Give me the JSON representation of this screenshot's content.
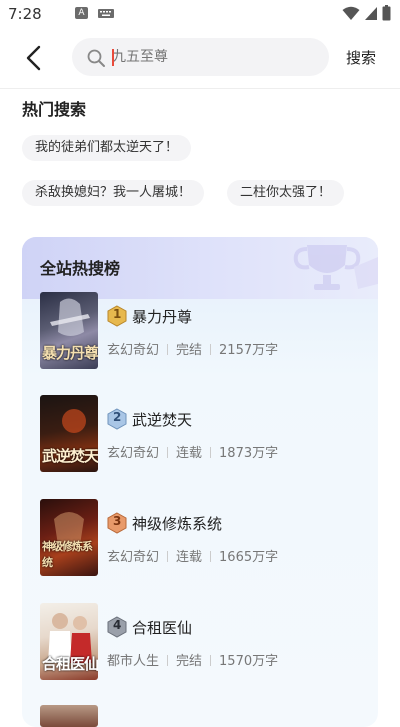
{
  "status": {
    "time": "7:28",
    "notif_letter": "A"
  },
  "search": {
    "placeholder": "九五至尊",
    "button_label": "搜索"
  },
  "hot_search": {
    "title": "热门搜索",
    "chips": [
      "我的徒弟们都太逆天了！",
      "杀敌换媳妇？我一人屠城！",
      "二柱你太强了！"
    ]
  },
  "ranking": {
    "title": "全站热搜榜",
    "books": [
      {
        "rank": "1",
        "name": "暴力丹尊",
        "genre": "玄幻奇幻",
        "status": "完结",
        "words": "2157万字",
        "cover_text": "暴力丹尊",
        "badge_color": "#d9a441"
      },
      {
        "rank": "2",
        "name": "武逆焚天",
        "genre": "玄幻奇幻",
        "status": "连载",
        "words": "1873万字",
        "cover_text": "武逆焚天",
        "badge_color": "#7fa3c9"
      },
      {
        "rank": "3",
        "name": "神级修炼系统",
        "genre": "玄幻奇幻",
        "status": "连载",
        "words": "1665万字",
        "cover_text": "神级修炼系统",
        "badge_color": "#d98a5a"
      },
      {
        "rank": "4",
        "name": "合租医仙",
        "genre": "都市人生",
        "status": "完结",
        "words": "1570万字",
        "cover_text": "合租医仙",
        "badge_color": "#8a8f9a"
      }
    ]
  }
}
